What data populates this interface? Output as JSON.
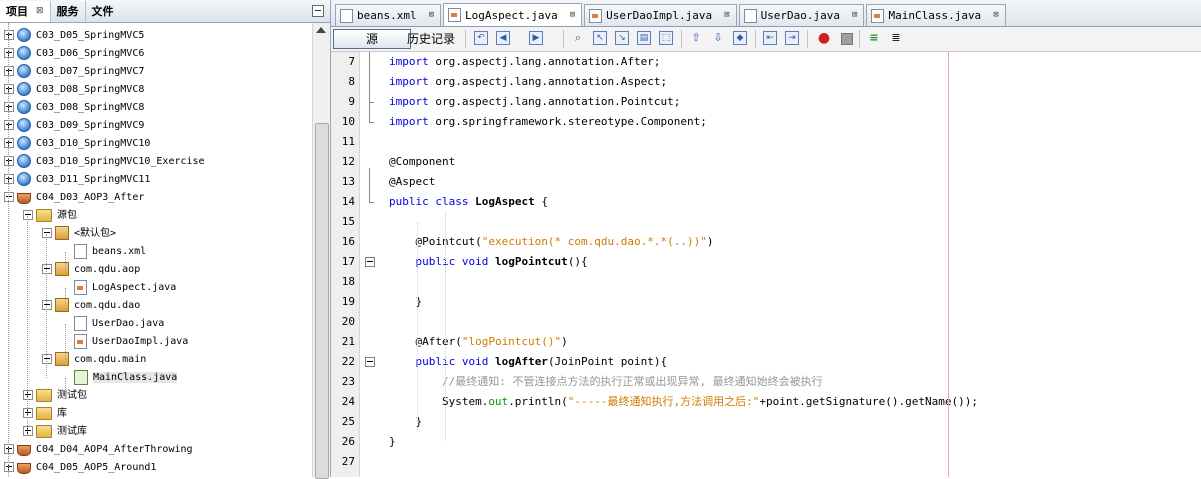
{
  "left_panel": {
    "tabs": [
      {
        "label": "项目",
        "close": "⊠"
      },
      {
        "label": "服务"
      },
      {
        "label": "文件"
      }
    ],
    "minimize_icon": "minimize-icon",
    "tree": [
      {
        "label": "C03_D05_SpringMVC5",
        "icon": "globe",
        "toggle": "plus",
        "level": 0
      },
      {
        "label": "C03_D06_SpringMVC6",
        "icon": "globe",
        "toggle": "plus",
        "level": 0
      },
      {
        "label": "C03_D07_SpringMVC7",
        "icon": "globe",
        "toggle": "plus",
        "level": 0
      },
      {
        "label": "C03_D08_SpringMVC8",
        "icon": "globe",
        "toggle": "plus",
        "level": 0
      },
      {
        "label": "C03_D08_SpringMVC8",
        "icon": "globe",
        "toggle": "plus",
        "level": 0
      },
      {
        "label": "C03_D09_SpringMVC9",
        "icon": "globe",
        "toggle": "plus",
        "level": 0
      },
      {
        "label": "C03_D10_SpringMVC10",
        "icon": "globe",
        "toggle": "plus",
        "level": 0
      },
      {
        "label": "C03_D10_SpringMVC10_Exercise",
        "icon": "globe",
        "toggle": "plus",
        "level": 0
      },
      {
        "label": "C03_D11_SpringMVC11",
        "icon": "globe",
        "toggle": "plus",
        "level": 0
      },
      {
        "label": "C04_D03_AOP3_After",
        "icon": "cup",
        "toggle": "minus",
        "level": 0
      },
      {
        "label": "源包",
        "icon": "folder",
        "toggle": "minus",
        "level": 1
      },
      {
        "label": "<默认包>",
        "icon": "pkg",
        "toggle": "minus",
        "level": 2
      },
      {
        "label": "beans.xml",
        "icon": "file",
        "toggle": "",
        "level": 3
      },
      {
        "label": "com.qdu.aop",
        "icon": "pkg",
        "toggle": "minus",
        "level": 2
      },
      {
        "label": "LogAspect.java",
        "icon": "jfile",
        "toggle": "",
        "level": 3
      },
      {
        "label": "com.qdu.dao",
        "icon": "pkg",
        "toggle": "minus",
        "level": 2
      },
      {
        "label": "UserDao.java",
        "icon": "file",
        "toggle": "",
        "level": 3
      },
      {
        "label": "UserDaoImpl.java",
        "icon": "jfile",
        "toggle": "",
        "level": 3
      },
      {
        "label": "com.qdu.main",
        "icon": "pkg",
        "toggle": "minus",
        "level": 2
      },
      {
        "label": "MainClass.java",
        "icon": "mainfile",
        "toggle": "",
        "level": 3,
        "selected": true
      },
      {
        "label": "测试包",
        "icon": "folder",
        "toggle": "plus",
        "level": 1
      },
      {
        "label": "库",
        "icon": "folder",
        "toggle": "plus",
        "level": 1
      },
      {
        "label": "测试库",
        "icon": "folder",
        "toggle": "plus",
        "level": 1
      },
      {
        "label": "C04_D04_AOP4_AfterThrowing",
        "icon": "cup",
        "toggle": "plus",
        "level": 0
      },
      {
        "label": "C04_D05_AOP5_Around1",
        "icon": "cup",
        "toggle": "plus",
        "level": 0
      }
    ]
  },
  "editor": {
    "tabs": [
      {
        "label": "beans.xml",
        "icon": "xml",
        "close": "⊠"
      },
      {
        "label": "LogAspect.java",
        "icon": "java",
        "close": "⊠",
        "active": true
      },
      {
        "label": "UserDaoImpl.java",
        "icon": "java",
        "close": "⊠"
      },
      {
        "label": "UserDao.java",
        "icon": "java",
        "close": "⊠"
      },
      {
        "label": "MainClass.java",
        "icon": "java",
        "close": "⊠"
      }
    ],
    "toolbar": {
      "source_label": "源",
      "history_label": "历史记录"
    },
    "lines": [
      {
        "n": "7"
      },
      {
        "n": "8"
      },
      {
        "n": "9"
      },
      {
        "n": "10"
      },
      {
        "n": "11"
      },
      {
        "n": "12"
      },
      {
        "n": "13"
      },
      {
        "n": "14"
      },
      {
        "n": "15"
      },
      {
        "n": "16"
      },
      {
        "n": "17"
      },
      {
        "n": "18"
      },
      {
        "n": "19"
      },
      {
        "n": "20"
      },
      {
        "n": "21"
      },
      {
        "n": "22"
      },
      {
        "n": "23"
      },
      {
        "n": "24"
      },
      {
        "n": "25"
      },
      {
        "n": "26"
      },
      {
        "n": "27"
      }
    ],
    "code": {
      "l7_kw": "import",
      "l7_rest": " org.aspectj.lang.annotation.After;",
      "l8_kw": "import",
      "l8_rest": " org.aspectj.lang.annotation.Aspect;",
      "l9_kw": "import",
      "l9_rest": " org.aspectj.lang.annotation.Pointcut;",
      "l10_kw": "import",
      "l10_rest": " org.springframework.stereotype.Component;",
      "l12": "@Component",
      "l13": "@Aspect",
      "l14_kw": "public class",
      "l14_name": "LogAspect",
      "l14_rest": " {",
      "l16_a": "@Pointcut(",
      "l16_s": "\"execution(* com.qdu.dao.*.*(..))\"",
      "l16_b": ")",
      "l17_kw": "public void",
      "l17_name": "logPointcut",
      "l17_rest": "(){",
      "l19": "}",
      "l21_a": "@After(",
      "l21_s": "\"logPointcut()\"",
      "l21_b": ")",
      "l22_kw": "public void",
      "l22_name": "logAfter",
      "l22_rest": "(JoinPoint point){",
      "l23": "//最终通知: 不管连接点方法的执行正常或出现异常, 最终通知始终会被执行",
      "l24_a": "System.",
      "l24_f": "out",
      "l24_b": ".println(",
      "l24_s": "\"-----最终通知执行,方法调用之后:\"",
      "l24_c": "+point.getSignature().getName());",
      "l25": "}",
      "l26": "}"
    }
  }
}
